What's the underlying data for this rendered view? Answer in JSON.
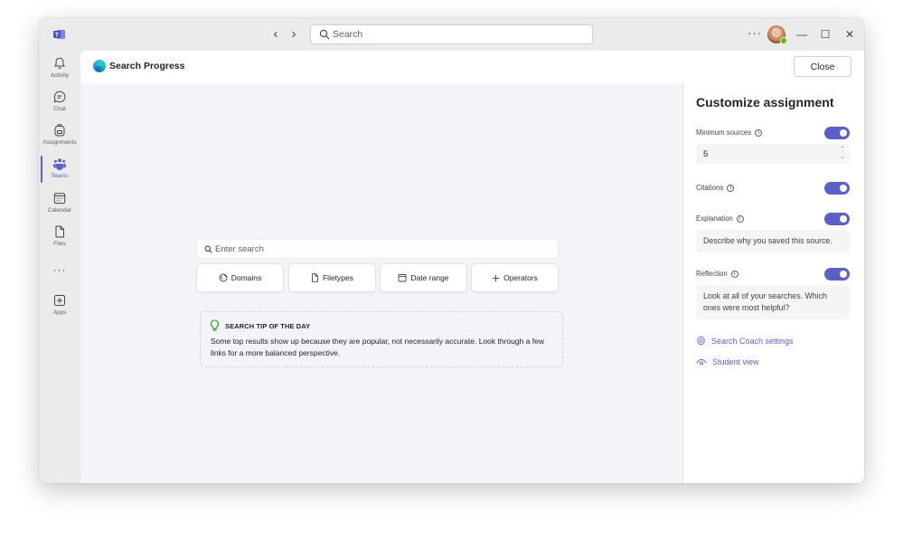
{
  "titlebar": {
    "search_placeholder": "Search",
    "back_arrow": "‹",
    "forward_arrow": "›",
    "more_glyph": "···",
    "minimize_glyph": "—",
    "maximize_glyph": "☐",
    "close_glyph": "✕"
  },
  "rail": {
    "items": [
      {
        "label": "Activity",
        "icon": "bell-icon"
      },
      {
        "label": "Chat",
        "icon": "chat-icon"
      },
      {
        "label": "Assignments",
        "icon": "backpack-icon"
      },
      {
        "label": "Teams",
        "icon": "teams-icon"
      },
      {
        "label": "Calendar",
        "icon": "calendar-icon"
      },
      {
        "label": "Files",
        "icon": "file-icon"
      },
      {
        "label": "Apps",
        "icon": "add-square-icon"
      }
    ],
    "more_glyph": "···",
    "active_item": "Teams"
  },
  "app": {
    "title": "Search Progress",
    "close_label": "Close"
  },
  "search": {
    "placeholder": "Enter search",
    "filters": [
      "Domains",
      "Filetypes",
      "Date range",
      "Operators"
    ]
  },
  "tip": {
    "title": "SEARCH TIP OF THE DAY",
    "text": "Some top results show up because they are popular, not necessarily accurate. Look through a few links for a more balanced perspective."
  },
  "panel": {
    "title": "Customize assignment",
    "minimum_sources": {
      "label": "Minimum sources",
      "value": "5",
      "enabled": true
    },
    "citations": {
      "label": "Citations",
      "enabled": true
    },
    "explanation": {
      "label": "Explanation",
      "enabled": true,
      "text": "Describe why you saved this source."
    },
    "reflection": {
      "label": "Reflection",
      "enabled": true,
      "text": "Look at all of your searches. Which ones were most helpful?"
    },
    "links": {
      "coach_settings": "Search Coach settings",
      "student_view": "Student view"
    }
  },
  "colors": {
    "accent": "#5b5fc7",
    "canvas": "#f3f4f8",
    "chrome": "#ebebeb"
  }
}
